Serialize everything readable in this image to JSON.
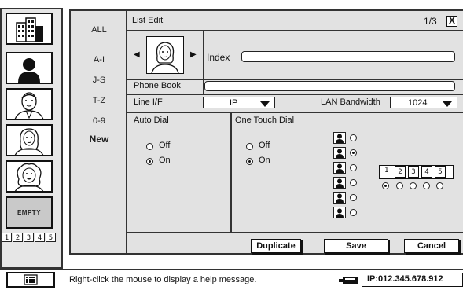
{
  "left_panel": {
    "thumbnails": [
      "building-icon",
      "silhouette-icon",
      "person-man-icon",
      "person-woman-icon",
      "person-curly-hair-icon"
    ],
    "empty_label": "EMPTY",
    "pages": [
      "1",
      "2",
      "3",
      "4",
      "5"
    ]
  },
  "index_column": {
    "items": [
      "ALL",
      "A-I",
      "J-S",
      "T-Z",
      "0-9",
      "New"
    ]
  },
  "list_edit": {
    "title": "List Edit",
    "page_indicator": "1/3",
    "close_label": "X",
    "index_label": "Index",
    "index_value": "",
    "phone_book_label": "Phone Book",
    "phone_book_value": "",
    "line_if_label": "Line I/F",
    "line_if_value": "IP",
    "lan_bandwidth_label": "LAN Bandwidth",
    "lan_bandwidth_value": "1024",
    "auto_dial": {
      "label": "Auto Dial",
      "options": [
        "Off",
        "On"
      ],
      "selected": "On"
    },
    "one_touch_dial": {
      "label": "One Touch Dial",
      "options": [
        "Off",
        "On"
      ],
      "selected": "On",
      "pages": [
        "1",
        "2",
        "3",
        "4",
        "5"
      ]
    },
    "buttons": {
      "duplicate": "Duplicate",
      "save": "Save",
      "cancel": "Cancel"
    }
  },
  "status": {
    "help_message": "Right-click the mouse to display a help message.",
    "ip": "IP:012.345.678.912"
  }
}
